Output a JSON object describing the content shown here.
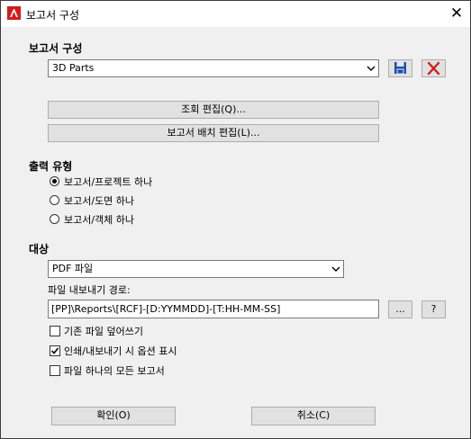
{
  "window": {
    "title": "보고서 구성",
    "close_label": "✕",
    "app_icon": "autocad-logo-icon"
  },
  "report_config": {
    "section_label": "보고서 구성",
    "selected": "3D Parts",
    "save_icon": "save-disk-icon",
    "delete_icon": "red-x-delete-icon",
    "edit_query_label": "조회 편집(Q)...",
    "edit_layout_label": "보고서 배치 편집(L)..."
  },
  "output_type": {
    "section_label": "출력 유형",
    "options": [
      {
        "label": "보고서/프로젝트 하나",
        "checked": true
      },
      {
        "label": "보고서/도면 하나",
        "checked": false
      },
      {
        "label": "보고서/객체 하나",
        "checked": false
      }
    ]
  },
  "target": {
    "section_label": "대상",
    "selected": "PDF 파일",
    "export_path_label": "파일 내보내기 경로:",
    "export_path_value": "[PP]\\Reports\\[RCF]-[D:YYMMDD]-[T:HH-MM-SS]",
    "browse_label": "...",
    "help_label": "?",
    "options": [
      {
        "label": "기존 파일 덮어쓰기",
        "checked": false
      },
      {
        "label": "인쇄/내보내기 시 옵션 표시",
        "checked": true
      },
      {
        "label": "파일 하나의 모든 보고서",
        "checked": false
      }
    ]
  },
  "footer": {
    "ok_label": "확인(O)",
    "cancel_label": "취소(C)"
  },
  "colors": {
    "accent_red": "#d41b1b",
    "save_blue": "#1f4fa8"
  }
}
